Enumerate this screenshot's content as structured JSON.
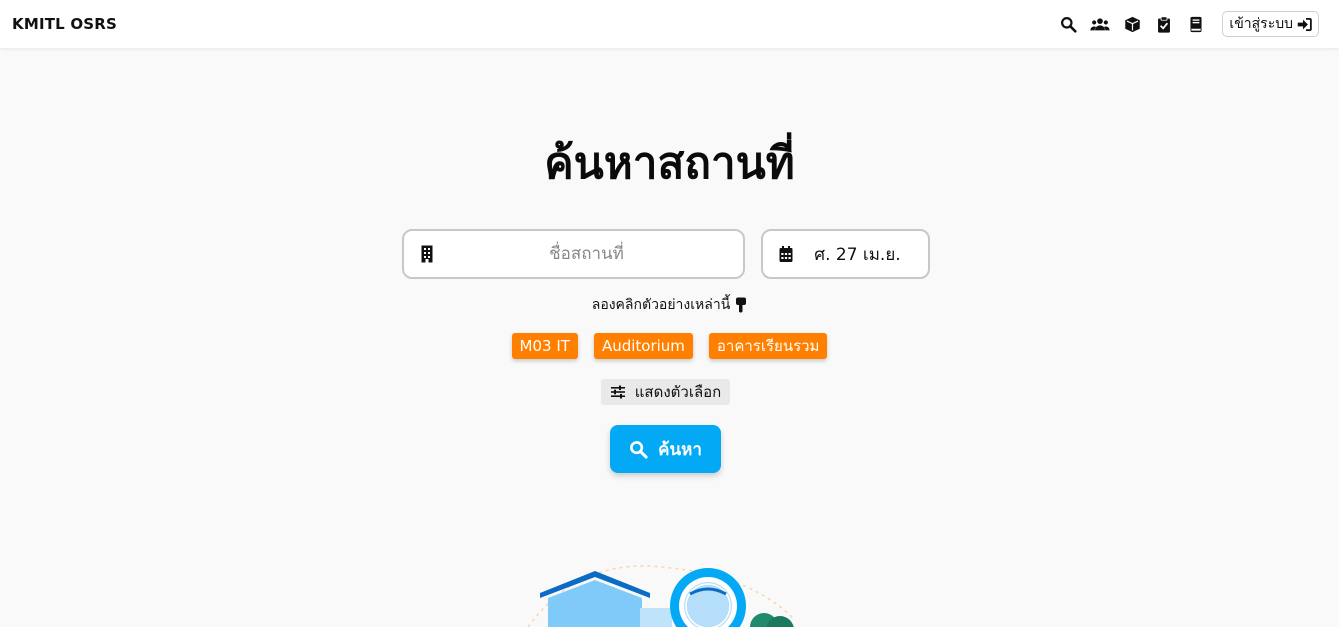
{
  "navbar": {
    "brand": "KMITL OSRS",
    "icons": [
      "search-icon",
      "users-icon",
      "cube-icon",
      "clipboard-check-icon",
      "book-icon"
    ],
    "login_label": "เข้าสู่ระบบ"
  },
  "main": {
    "title": "ค้นหาสถานที่",
    "place_placeholder": "ชื่อสถานที่",
    "date_value": "ศ. 27 เม.ย.",
    "hint": "ลองคลิกตัวอย่างเหล่านี้",
    "examples": [
      "M03 IT",
      "Auditorium",
      "อาคารเรียนรวม"
    ],
    "options_label": "แสดงตัวเลือก",
    "search_label": "ค้นหา"
  },
  "colors": {
    "accent": "#03a9f4",
    "chip": "#ff7f00",
    "background": "#f9f9f9"
  }
}
